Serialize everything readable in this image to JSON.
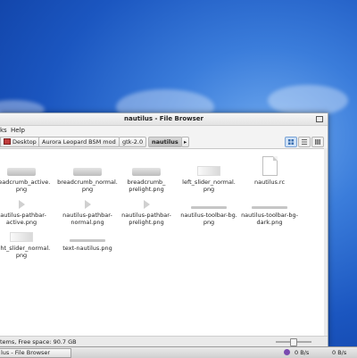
{
  "window": {
    "title": "nautilus - File Browser",
    "menu": [
      "ks",
      "Help"
    ]
  },
  "pathbar": {
    "crumbs": [
      "Desktop",
      "Aurora Leopard BSM mod",
      "gtk-2.0",
      "nautilus"
    ],
    "more": "▸"
  },
  "files": [
    {
      "name": "breadcrumb_active.\npng",
      "thumb": "wide"
    },
    {
      "name": "breadcrumb_normal.\npng",
      "thumb": "wide"
    },
    {
      "name": "breadcrumb_\nprelight.png",
      "thumb": "wide"
    },
    {
      "name": "left_slider_normal.\npng",
      "thumb": "slider"
    },
    {
      "name": "nautilus.rc",
      "thumb": "doc"
    },
    {
      "name": "nautilus-pathbar-\nactive.png",
      "thumb": "arrow"
    },
    {
      "name": "nautilus-pathbar-\nnormal.png",
      "thumb": "arrow"
    },
    {
      "name": "nautilus-pathbar-\nprelight.png",
      "thumb": "arrow"
    },
    {
      "name": "nautilus-toolbar-bg.\npng",
      "thumb": "line"
    },
    {
      "name": "nautilus-toolbar-bg-\ndark.png",
      "thumb": "line"
    },
    {
      "name": "right_slider_normal.\npng",
      "thumb": "slider"
    },
    {
      "name": "text-nautilus.png",
      "thumb": "line"
    }
  ],
  "status": {
    "text": "tems, Free space: 90.7 GB"
  },
  "taskbar": {
    "task_label": "lus - File Browser",
    "net_down": "0 B/s",
    "net_up": "0 B/s"
  },
  "colors": {
    "desktop": "#1b56c0",
    "active_view": "#cfe1f6"
  }
}
